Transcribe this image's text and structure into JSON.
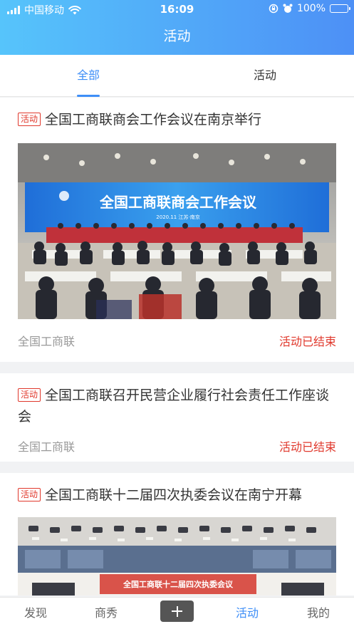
{
  "status_bar": {
    "carrier": "中国移动",
    "time": "16:09",
    "battery": "100%",
    "icons": [
      "signal-icon",
      "wifi-icon",
      "rotation-lock-icon",
      "alarm-icon",
      "battery-charging-icon"
    ]
  },
  "header": {
    "title": "活动"
  },
  "tabs": [
    {
      "label": "全部",
      "active": true
    },
    {
      "label": "活动",
      "active": false
    }
  ],
  "items": [
    {
      "tag": "活动",
      "title": "全国工商联商会工作会议在南京举行",
      "image": {
        "banner_title": "全国工商联商会工作会议",
        "banner_sub": "2020.11 江苏·南京"
      },
      "source": "全国工商联",
      "status": "活动已结束"
    },
    {
      "tag": "活动",
      "title": "全国工商联召开民营企业履行社会责任工作座谈会",
      "source": "全国工商联",
      "status": "活动已结束"
    },
    {
      "tag": "活动",
      "title": "全国工商联十二届四次执委会议在南宁开幕",
      "image": {
        "banner_title": "全国工商联十二届四次执委会议"
      }
    }
  ],
  "bottom_nav": {
    "discover": "发现",
    "showcase": "商秀",
    "add_icon": "plus-icon",
    "activity": "活动",
    "mine": "我的",
    "active": "activity"
  },
  "colors": {
    "header_gradient_start": "#56c4fb",
    "header_gradient_end": "#4d90f6",
    "accent": "#3e8ef7",
    "tag_red": "#e0382c",
    "status_red": "#e0382c"
  }
}
